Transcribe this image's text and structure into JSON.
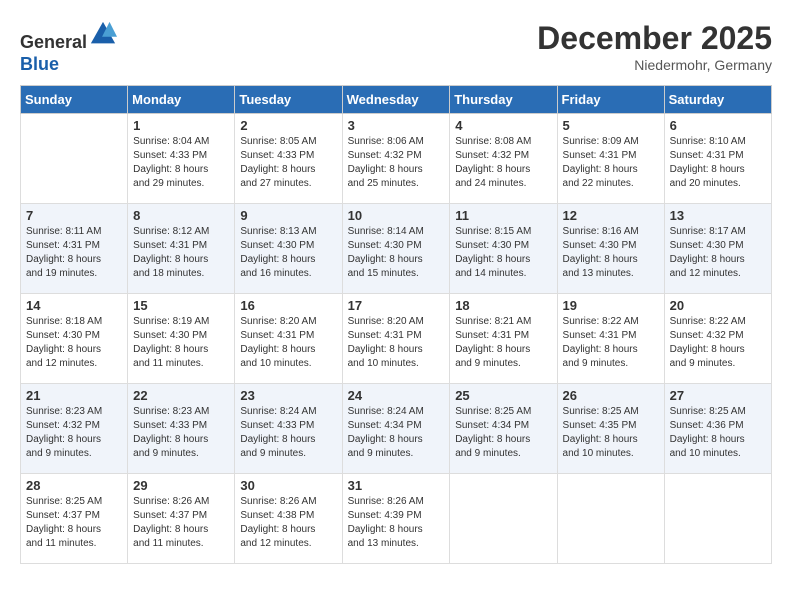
{
  "header": {
    "logo_line1": "General",
    "logo_line2": "Blue",
    "month_title": "December 2025",
    "location": "Niedermohr, Germany"
  },
  "weekdays": [
    "Sunday",
    "Monday",
    "Tuesday",
    "Wednesday",
    "Thursday",
    "Friday",
    "Saturday"
  ],
  "weeks": [
    [
      {
        "day": "",
        "info": ""
      },
      {
        "day": "1",
        "info": "Sunrise: 8:04 AM\nSunset: 4:33 PM\nDaylight: 8 hours\nand 29 minutes."
      },
      {
        "day": "2",
        "info": "Sunrise: 8:05 AM\nSunset: 4:33 PM\nDaylight: 8 hours\nand 27 minutes."
      },
      {
        "day": "3",
        "info": "Sunrise: 8:06 AM\nSunset: 4:32 PM\nDaylight: 8 hours\nand 25 minutes."
      },
      {
        "day": "4",
        "info": "Sunrise: 8:08 AM\nSunset: 4:32 PM\nDaylight: 8 hours\nand 24 minutes."
      },
      {
        "day": "5",
        "info": "Sunrise: 8:09 AM\nSunset: 4:31 PM\nDaylight: 8 hours\nand 22 minutes."
      },
      {
        "day": "6",
        "info": "Sunrise: 8:10 AM\nSunset: 4:31 PM\nDaylight: 8 hours\nand 20 minutes."
      }
    ],
    [
      {
        "day": "7",
        "info": "Sunrise: 8:11 AM\nSunset: 4:31 PM\nDaylight: 8 hours\nand 19 minutes."
      },
      {
        "day": "8",
        "info": "Sunrise: 8:12 AM\nSunset: 4:31 PM\nDaylight: 8 hours\nand 18 minutes."
      },
      {
        "day": "9",
        "info": "Sunrise: 8:13 AM\nSunset: 4:30 PM\nDaylight: 8 hours\nand 16 minutes."
      },
      {
        "day": "10",
        "info": "Sunrise: 8:14 AM\nSunset: 4:30 PM\nDaylight: 8 hours\nand 15 minutes."
      },
      {
        "day": "11",
        "info": "Sunrise: 8:15 AM\nSunset: 4:30 PM\nDaylight: 8 hours\nand 14 minutes."
      },
      {
        "day": "12",
        "info": "Sunrise: 8:16 AM\nSunset: 4:30 PM\nDaylight: 8 hours\nand 13 minutes."
      },
      {
        "day": "13",
        "info": "Sunrise: 8:17 AM\nSunset: 4:30 PM\nDaylight: 8 hours\nand 12 minutes."
      }
    ],
    [
      {
        "day": "14",
        "info": "Sunrise: 8:18 AM\nSunset: 4:30 PM\nDaylight: 8 hours\nand 12 minutes."
      },
      {
        "day": "15",
        "info": "Sunrise: 8:19 AM\nSunset: 4:30 PM\nDaylight: 8 hours\nand 11 minutes."
      },
      {
        "day": "16",
        "info": "Sunrise: 8:20 AM\nSunset: 4:31 PM\nDaylight: 8 hours\nand 10 minutes."
      },
      {
        "day": "17",
        "info": "Sunrise: 8:20 AM\nSunset: 4:31 PM\nDaylight: 8 hours\nand 10 minutes."
      },
      {
        "day": "18",
        "info": "Sunrise: 8:21 AM\nSunset: 4:31 PM\nDaylight: 8 hours\nand 9 minutes."
      },
      {
        "day": "19",
        "info": "Sunrise: 8:22 AM\nSunset: 4:31 PM\nDaylight: 8 hours\nand 9 minutes."
      },
      {
        "day": "20",
        "info": "Sunrise: 8:22 AM\nSunset: 4:32 PM\nDaylight: 8 hours\nand 9 minutes."
      }
    ],
    [
      {
        "day": "21",
        "info": "Sunrise: 8:23 AM\nSunset: 4:32 PM\nDaylight: 8 hours\nand 9 minutes."
      },
      {
        "day": "22",
        "info": "Sunrise: 8:23 AM\nSunset: 4:33 PM\nDaylight: 8 hours\nand 9 minutes."
      },
      {
        "day": "23",
        "info": "Sunrise: 8:24 AM\nSunset: 4:33 PM\nDaylight: 8 hours\nand 9 minutes."
      },
      {
        "day": "24",
        "info": "Sunrise: 8:24 AM\nSunset: 4:34 PM\nDaylight: 8 hours\nand 9 minutes."
      },
      {
        "day": "25",
        "info": "Sunrise: 8:25 AM\nSunset: 4:34 PM\nDaylight: 8 hours\nand 9 minutes."
      },
      {
        "day": "26",
        "info": "Sunrise: 8:25 AM\nSunset: 4:35 PM\nDaylight: 8 hours\nand 10 minutes."
      },
      {
        "day": "27",
        "info": "Sunrise: 8:25 AM\nSunset: 4:36 PM\nDaylight: 8 hours\nand 10 minutes."
      }
    ],
    [
      {
        "day": "28",
        "info": "Sunrise: 8:25 AM\nSunset: 4:37 PM\nDaylight: 8 hours\nand 11 minutes."
      },
      {
        "day": "29",
        "info": "Sunrise: 8:26 AM\nSunset: 4:37 PM\nDaylight: 8 hours\nand 11 minutes."
      },
      {
        "day": "30",
        "info": "Sunrise: 8:26 AM\nSunset: 4:38 PM\nDaylight: 8 hours\nand 12 minutes."
      },
      {
        "day": "31",
        "info": "Sunrise: 8:26 AM\nSunset: 4:39 PM\nDaylight: 8 hours\nand 13 minutes."
      },
      {
        "day": "",
        "info": ""
      },
      {
        "day": "",
        "info": ""
      },
      {
        "day": "",
        "info": ""
      }
    ]
  ]
}
